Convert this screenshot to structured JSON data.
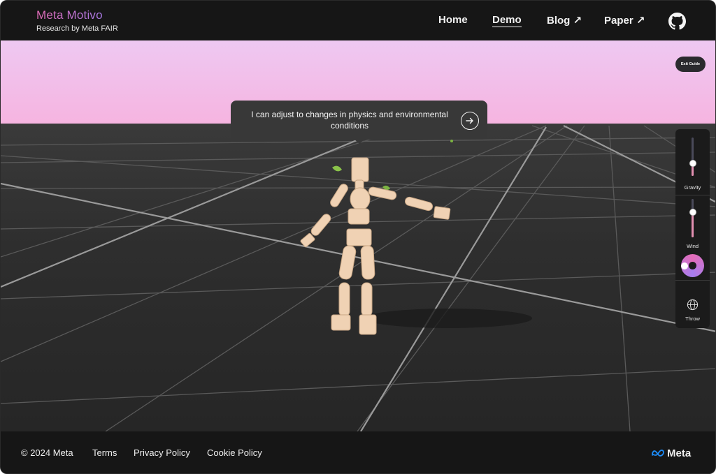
{
  "header": {
    "brand_title": "Meta Motivo",
    "brand_subtitle": "Research by Meta FAIR",
    "nav": [
      {
        "label": "Home",
        "active": false
      },
      {
        "label": "Demo",
        "active": true
      },
      {
        "label": "Blog ↗",
        "active": false
      },
      {
        "label": "Paper ↗",
        "active": false
      }
    ],
    "github_icon": "github-icon"
  },
  "scene": {
    "exit_guide_label": "Exit Guide",
    "tooltip": {
      "text": "I can adjust to changes in physics and environmental conditions",
      "next_icon": "arrow-right-icon"
    },
    "controls": {
      "gravity": {
        "label": "Gravity",
        "value": 0.3
      },
      "wind": {
        "label": "Wind",
        "value": 0.65,
        "direction_icon": "wind-direction-dial-icon"
      },
      "throw": {
        "label": "Throw",
        "icon": "globe-icon"
      }
    },
    "colors": {
      "sky_top": "#f0c6f0",
      "sky_horizon": "#f4b8e4",
      "ground": "#282828",
      "grid_line": "#8a8a8a",
      "accent": "#e28fb0",
      "figure": "#f0d2b4"
    }
  },
  "footer": {
    "copyright": "© 2024 Meta",
    "links": [
      "Terms",
      "Privacy Policy",
      "Cookie Policy"
    ],
    "logo_text": "Meta"
  }
}
